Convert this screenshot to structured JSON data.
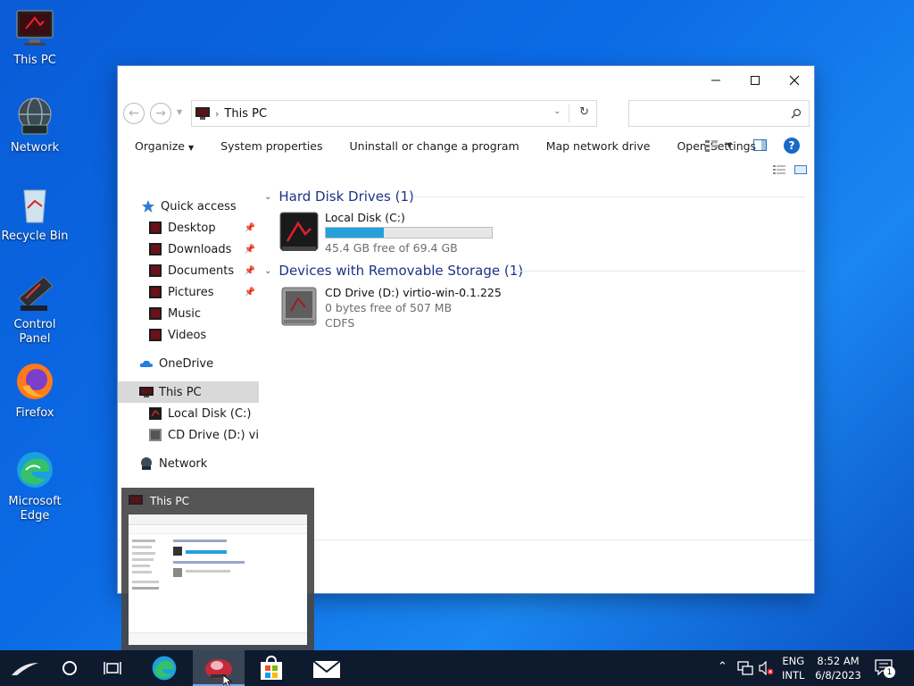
{
  "desktop": {
    "icons": [
      {
        "label": "This PC"
      },
      {
        "label": "Network"
      },
      {
        "label": "Recycle Bin"
      },
      {
        "label": "Control\nPanel"
      },
      {
        "label": "Firefox"
      },
      {
        "label": "Microsoft\nEdge"
      }
    ]
  },
  "window": {
    "address": "This PC",
    "search_placeholder": "",
    "toolbar": [
      "Organize",
      "System properties",
      "Uninstall or change a program",
      "Map network drive",
      "Open Settings"
    ],
    "nav": {
      "quick_access": "Quick access",
      "quick_items": [
        "Desktop",
        "Downloads",
        "Documents",
        "Pictures",
        "Music",
        "Videos"
      ],
      "onedrive": "OneDrive",
      "this_pc": "This PC",
      "local_disk": "Local Disk (C:)",
      "cd_drive": "CD Drive (D:) virtic",
      "network": "Network"
    },
    "groups": {
      "hdd": "Hard Disk Drives (1)",
      "removable": "Devices with Removable Storage (1)"
    },
    "drives": {
      "c": {
        "name": "Local Disk (C:)",
        "free": "45.4 GB free of 69.4 GB",
        "used_fraction": 0.35
      },
      "d": {
        "name": "CD Drive (D:) virtio-win-0.1.225",
        "free": "0 bytes free of 507 MB",
        "fs": "CDFS"
      }
    }
  },
  "preview": {
    "title": "This PC"
  },
  "taskbar": {
    "lang1": "ENG",
    "lang2": "INTL",
    "time": "8:52 AM",
    "date": "6/8/2023",
    "notification_count": "1"
  },
  "colors": {
    "accent": "#26a0da",
    "group_heading": "#1e3287",
    "taskbar": "#0e1a2e"
  }
}
